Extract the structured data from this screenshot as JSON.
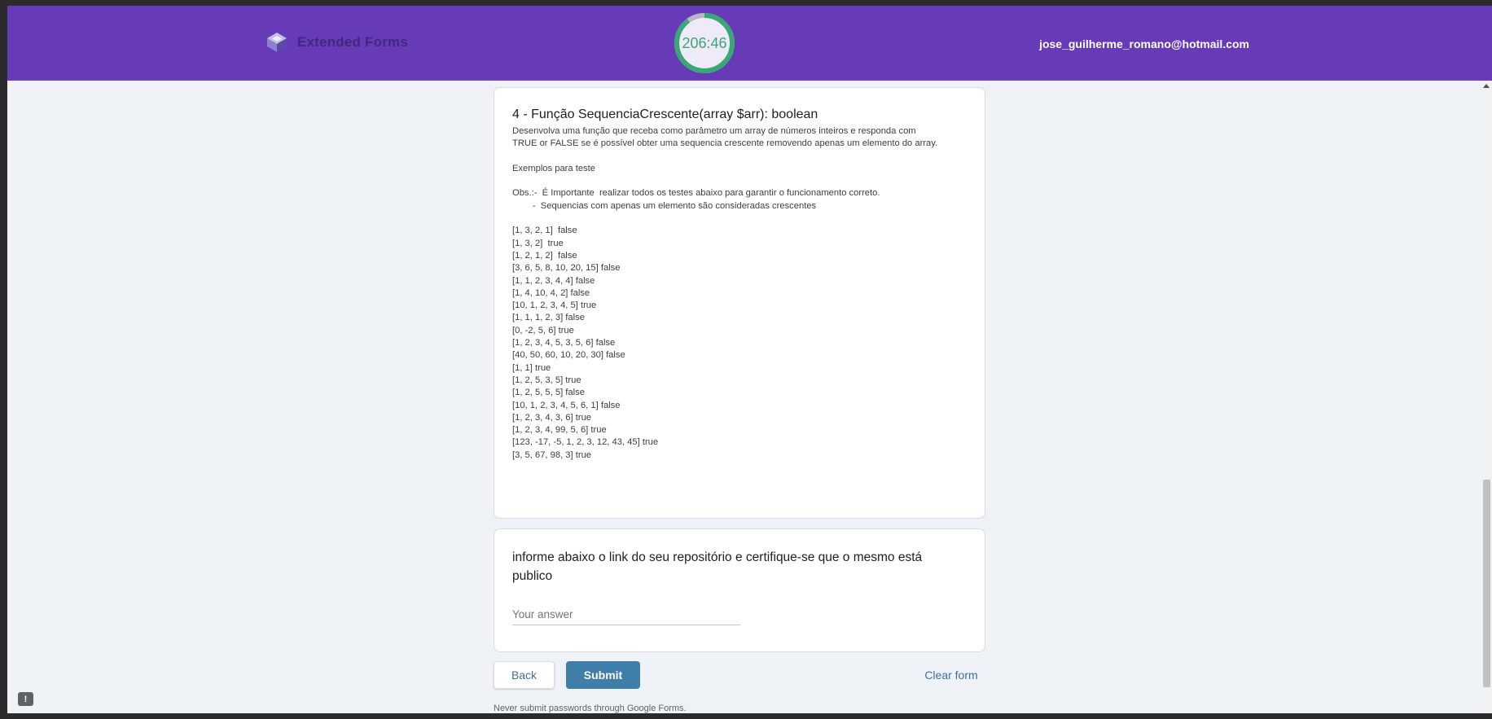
{
  "header": {
    "brand": "Extended Forms",
    "timer": "206:46",
    "timer_progress": 0.9,
    "email": "jose_guilherme_romano@hotmail.com",
    "colors": {
      "bar": "#673ab7",
      "timer_ring": "#3aa776"
    }
  },
  "question4": {
    "title": "4 - Função SequenciaCrescente(array $arr): boolean",
    "description": [
      "Desenvolva uma função que receba como parâmetro um array de números inteiros e responda com",
      "TRUE or FALSE se é possível obter uma sequencia crescente removendo apenas um elemento do array.",
      "",
      "Exemplos para teste",
      "",
      "Obs.:-  É Importante  realizar todos os testes abaixo para garantir o funcionamento correto.",
      "        -  Sequencias com apenas um elemento são consideradas crescentes",
      "",
      "[1, 3, 2, 1]  false",
      "[1, 3, 2]  true",
      "[1, 2, 1, 2]  false",
      "[3, 6, 5, 8, 10, 20, 15] false",
      "[1, 1, 2, 3, 4, 4] false",
      "[1, 4, 10, 4, 2] false",
      "[10, 1, 2, 3, 4, 5] true",
      "[1, 1, 1, 2, 3] false",
      "[0, -2, 5, 6] true",
      "[1, 2, 3, 4, 5, 3, 5, 6] false",
      "[40, 50, 60, 10, 20, 30] false",
      "[1, 1] true",
      "[1, 2, 5, 3, 5] true",
      "[1, 2, 5, 5, 5] false",
      "[10, 1, 2, 3, 4, 5, 6, 1] false",
      "[1, 2, 3, 4, 3, 6] true",
      "[1, 2, 3, 4, 99, 5, 6] true",
      "[123, -17, -5, 1, 2, 3, 12, 43, 45] true",
      "[3, 5, 67, 98, 3] true"
    ]
  },
  "question5": {
    "title": "informe abaixo o link do seu repositório e certifique-se que o mesmo está publico",
    "placeholder": "Your answer",
    "value": ""
  },
  "actions": {
    "back": "Back",
    "submit": "Submit",
    "clear": "Clear form"
  },
  "footer": {
    "note": "Never submit passwords through Google Forms."
  },
  "feedback_label": "!"
}
